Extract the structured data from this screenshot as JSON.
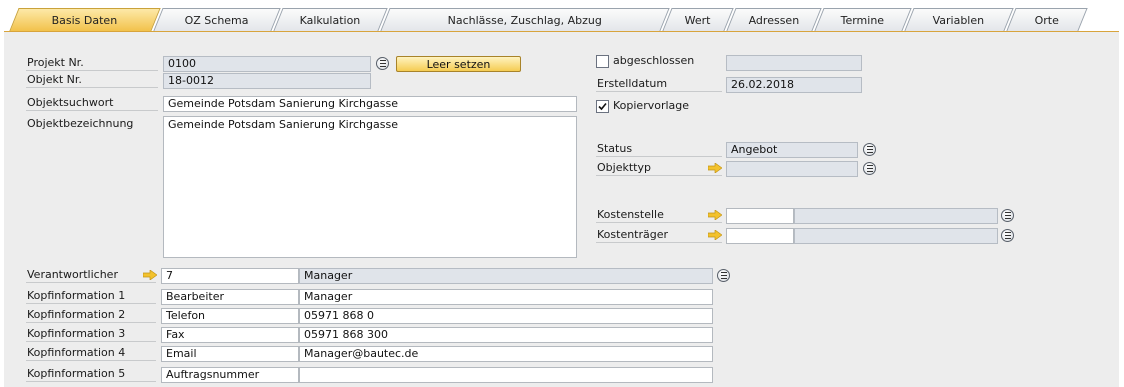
{
  "tabs": [
    {
      "label": "Basis Daten",
      "active": true
    },
    {
      "label": "OZ Schema"
    },
    {
      "label": "Kalkulation"
    },
    {
      "label": "Nachlässe, Zuschlag, Abzug"
    },
    {
      "label": "Wert"
    },
    {
      "label": "Adressen"
    },
    {
      "label": "Termine"
    },
    {
      "label": "Variablen"
    },
    {
      "label": "Orte"
    }
  ],
  "colors": {
    "active_tab": "#f2c24c",
    "readonly_field": "#e0e4ea",
    "arrow": "#f3c22c"
  },
  "icons": {
    "link": "list-link-icon",
    "arrow": "link-arrow-icon",
    "check": "checkmark-icon"
  },
  "left": {
    "projekt_nr": {
      "label": "Projekt Nr.",
      "value": "0100"
    },
    "leer_setzen": "Leer setzen",
    "objekt_nr": {
      "label": "Objekt Nr.",
      "value": "18-0012"
    },
    "objektsuchwort": {
      "label": "Objektsuchwort",
      "value": "Gemeinde Potsdam  Sanierung Kirchgasse"
    },
    "objektbezeichnung": {
      "label": "Objektbezeichnung",
      "value": "Gemeinde Potsdam  Sanierung Kirchgasse"
    }
  },
  "right": {
    "abgeschlossen": {
      "label": "abgeschlossen",
      "checked": false,
      "value": ""
    },
    "erstelldatum": {
      "label": "Erstelldatum",
      "value": "26.02.2018"
    },
    "kopiervorlage": {
      "label": "Kopiervorlage",
      "checked": true
    },
    "status": {
      "label": "Status",
      "value": "Angebot"
    },
    "objekttyp": {
      "label": "Objekttyp",
      "value": ""
    },
    "kostenstelle": {
      "label": "Kostenstelle",
      "code": "",
      "name": ""
    },
    "kostentraeger": {
      "label": "Kostenträger",
      "code": "",
      "name": ""
    }
  },
  "bottom": {
    "verantwortlicher": {
      "label": "Verantwortlicher",
      "code": "7",
      "name": "Manager"
    },
    "kopfinfo": [
      {
        "label": "Kopfinformation 1",
        "key": "Bearbeiter",
        "value": "Manager"
      },
      {
        "label": "Kopfinformation 2",
        "key": "Telefon",
        "value": "05971 868 0"
      },
      {
        "label": "Kopfinformation 3",
        "key": "Fax",
        "value": "05971 868 300"
      },
      {
        "label": "Kopfinformation 4",
        "key": "Email",
        "value": "Manager@bautec.de"
      },
      {
        "label": "Kopfinformation 5",
        "key": "Auftragsnummer",
        "value": ""
      }
    ]
  }
}
